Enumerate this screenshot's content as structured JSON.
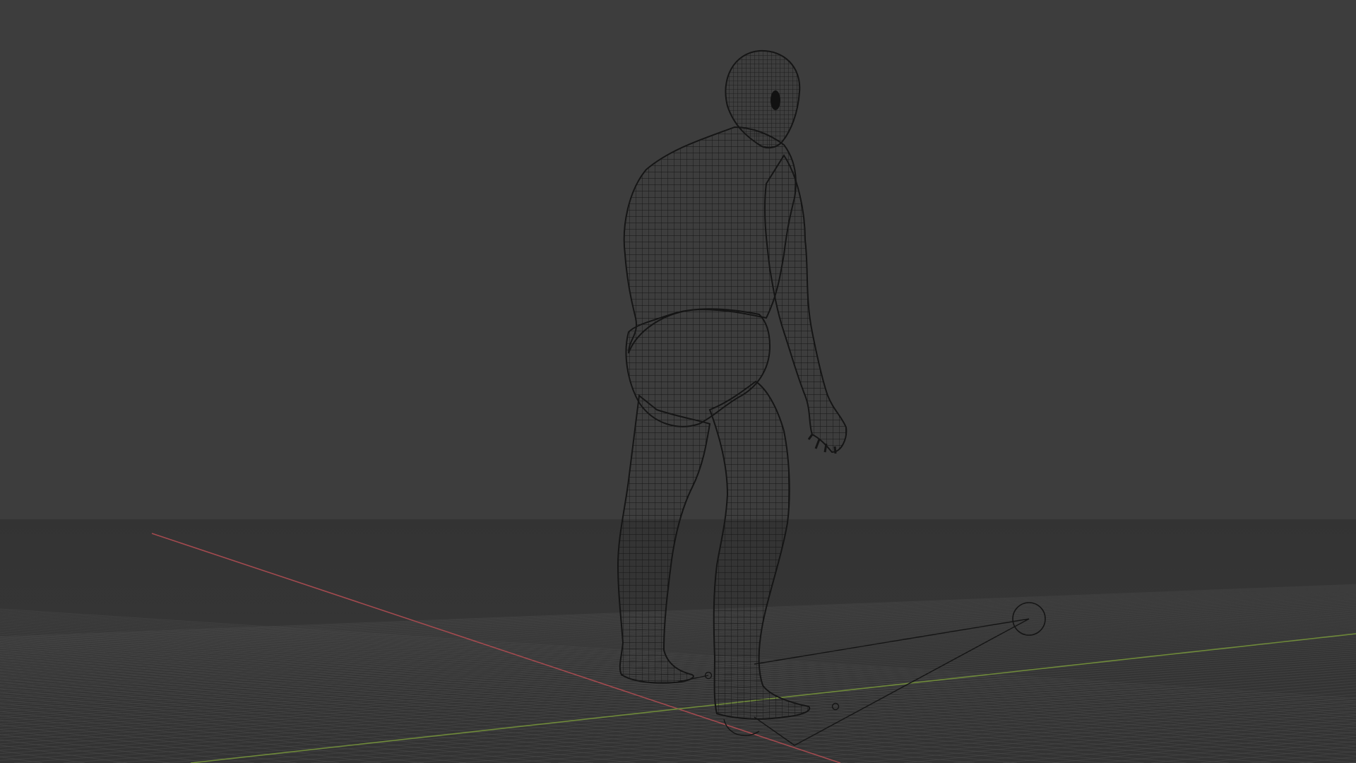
{
  "viewport": {
    "colors": {
      "background_top": "#3d3d3d",
      "background_bottom": "#333333",
      "grid_line": "#4a4a4a",
      "x_axis": "#a34a4f",
      "y_axis": "#6f8a3a",
      "wire": "#1a1a1a",
      "wire_fill": "#2b2b2b",
      "helper": "#151515"
    },
    "icons": {
      "model": "wireframe-humanoid-mesh",
      "rig": "ik-control-handles"
    }
  }
}
